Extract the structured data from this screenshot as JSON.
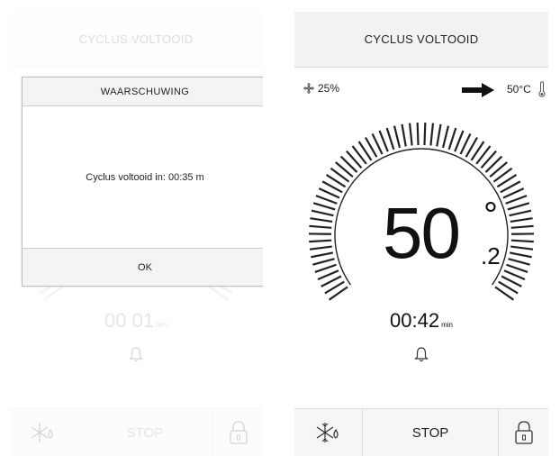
{
  "left_screen": {
    "header_title": "CYCLUS VOLTOOID",
    "timer_value": "00 01",
    "timer_unit": "min",
    "stop_label": "STOP",
    "dialog": {
      "title": "WAARSCHUWING",
      "message": "Cyclus voltooid in: 00:35 m",
      "ok_label": "OK"
    }
  },
  "right_screen": {
    "header_title": "CYCLUS VOLTOOID",
    "fan_speed": "25%",
    "set_temperature": "50°C",
    "temperature_whole": "50",
    "temperature_degree": "°",
    "temperature_decimal": ".2",
    "timer_value": "00:42",
    "timer_unit": "min",
    "stop_label": "STOP"
  },
  "icons": {
    "fan": "fan-icon",
    "arrow": "arrow-right-icon",
    "thermometer": "thermometer-icon",
    "bell": "bell-icon",
    "defrost": "snowflake-drop-icon",
    "lock": "lock-icon"
  },
  "colors": {
    "header_bg": "#f2f2f2",
    "text": "#222222",
    "dial_ticks": "#222222",
    "dial_ticks_left": "#cccccc"
  }
}
